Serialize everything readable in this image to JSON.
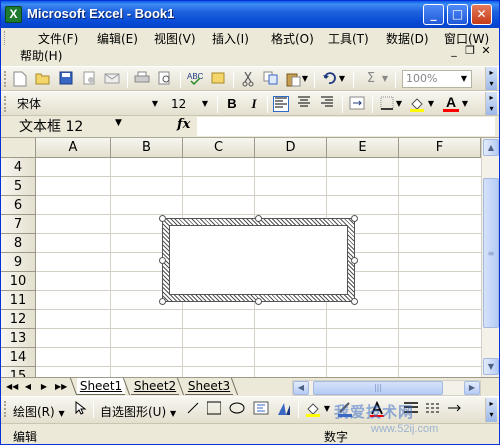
{
  "window": {
    "app_icon_letter": "X",
    "title": "Microsoft Excel - Book1",
    "minimize_glyph": "_",
    "maximize_glyph": "□",
    "close_glyph": "✕"
  },
  "menu": {
    "items": [
      "文件(F)",
      "编辑(E)",
      "视图(V)",
      "插入(I)",
      "格式(O)",
      "工具(T)",
      "数据(D)",
      "窗口(W)",
      "帮助(H)"
    ],
    "mdi_minimize": "_",
    "mdi_restore": "❐",
    "mdi_close": "✕"
  },
  "standard_toolbar": {
    "icons": [
      "new-icon",
      "open-icon",
      "save-icon",
      "permission-icon",
      "email-icon",
      "print-icon",
      "print-preview-icon",
      "spelling-icon",
      "research-icon",
      "cut-icon",
      "copy-icon",
      "paste-icon",
      "undo-icon",
      "autosum-icon"
    ],
    "sigma": "Σ",
    "zoom_value": "100%"
  },
  "format_toolbar": {
    "font_name": "宋体",
    "font_size": "12",
    "bold": "B",
    "italic": "I",
    "font_color_label": "A"
  },
  "formula_bar": {
    "name_box": "文本框 12",
    "fx": "fx",
    "formula": ""
  },
  "grid": {
    "columns": [
      "A",
      "B",
      "C",
      "D",
      "E",
      "F"
    ],
    "rows": [
      "4",
      "5",
      "6",
      "7",
      "8",
      "9",
      "10",
      "11",
      "12",
      "13",
      "14",
      "15"
    ]
  },
  "sheets": {
    "tabs": [
      "Sheet1",
      "Sheet2",
      "Sheet3"
    ],
    "active": "Sheet1",
    "nav": [
      "◀◀",
      "◀",
      "▶",
      "▶▶"
    ]
  },
  "drawing_toolbar": {
    "draw_label": "绘图(R)",
    "autoshapes_label": "自选图形(U)"
  },
  "status": {
    "left": "编辑",
    "right": "数字"
  },
  "watermark": {
    "text": "我爱技术网",
    "url": "www.52ij.com"
  },
  "colors": {
    "title_bar": "#0549d6",
    "chrome": "#ece9d8",
    "gridline": "#d4d0c8",
    "font_color_underline": "#ff0000",
    "fill_color_underline": "#ffff00"
  }
}
